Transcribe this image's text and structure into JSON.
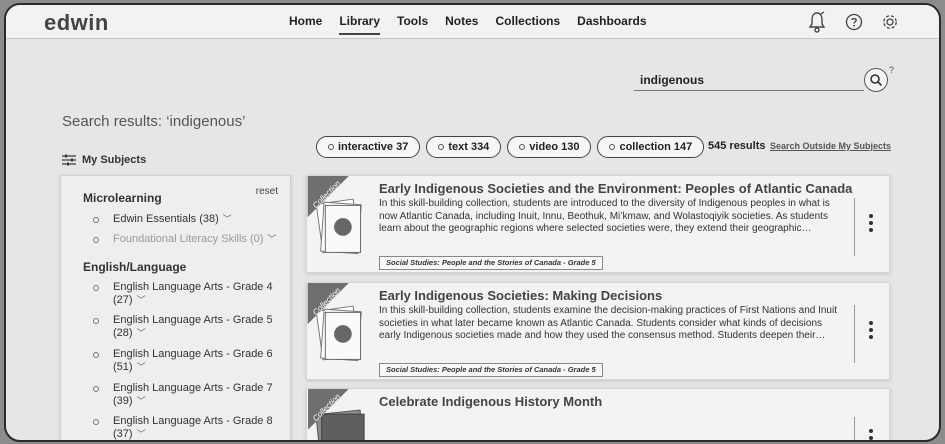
{
  "app": {
    "logo": "edwin"
  },
  "nav": {
    "items": [
      {
        "label": "Home"
      },
      {
        "label": "Library",
        "active": true
      },
      {
        "label": "Tools"
      },
      {
        "label": "Notes"
      },
      {
        "label": "Collections"
      },
      {
        "label": "Dashboards"
      }
    ],
    "icons": [
      "notification-bell-icon",
      "help-icon",
      "settings-gear-icon"
    ]
  },
  "search": {
    "value": "indigenous",
    "help": "?"
  },
  "results": {
    "title": "Search results: ‘indigenous’",
    "count": "545 results",
    "search_outside": "Search Outside My Subjects"
  },
  "filters": [
    {
      "label": "interactive 37"
    },
    {
      "label": "text 334"
    },
    {
      "label": "video 130"
    },
    {
      "label": "collection 147"
    }
  ],
  "sidebar": {
    "heading": "My Subjects",
    "reset": "reset",
    "sections": [
      {
        "title": "Microlearning",
        "items": [
          {
            "label": "Edwin Essentials (38)",
            "muted": false
          },
          {
            "label": "Foundational Literacy Skills (0)",
            "muted": true
          }
        ]
      },
      {
        "title": "English/Language",
        "items": [
          {
            "line1": "English Language Arts - Grade 4",
            "line2": "(27)"
          },
          {
            "line1": "English Language Arts - Grade 5",
            "line2": "(28)"
          },
          {
            "line1": "English Language Arts - Grade 6",
            "line2": "(51)"
          },
          {
            "line1": "English Language Arts - Grade 7",
            "line2": "(39)"
          },
          {
            "line1": "English Language Arts - Grade 8",
            "line2": "(37)"
          }
        ]
      }
    ]
  },
  "cards": [
    {
      "badge": "Collection",
      "title": "Early Indigenous Societies and the Environment: Peoples of Atlantic Canada",
      "description": "In this skill-building collection, students are introduced to the diversity of Indigenous peoples in what is now Atlantic Canada, including Inuit, Innu, Beothuk, Mi’kmaw, and Wolastoqiyik societies. As students learn about the geographic regions where selected societies were, they extend their geographic…",
      "tag": "Social Studies: People and the Stories of Canada - Grade 5"
    },
    {
      "badge": "Collection",
      "title": "Early Indigenous Societies: Making Decisions",
      "description": "In this skill-building collection, students examine the decision-making practices of First Nations and Inuit societies in what later became known as Atlantic Canada. Students consider what kinds of decisions early Indigenous societies made and how they used the consensus method. Students deepen their…",
      "tag": "Social Studies: People and the Stories of Canada - Grade 5"
    },
    {
      "badge": "Collection",
      "title": "Celebrate Indigenous History Month",
      "description": "",
      "tag": ""
    }
  ]
}
